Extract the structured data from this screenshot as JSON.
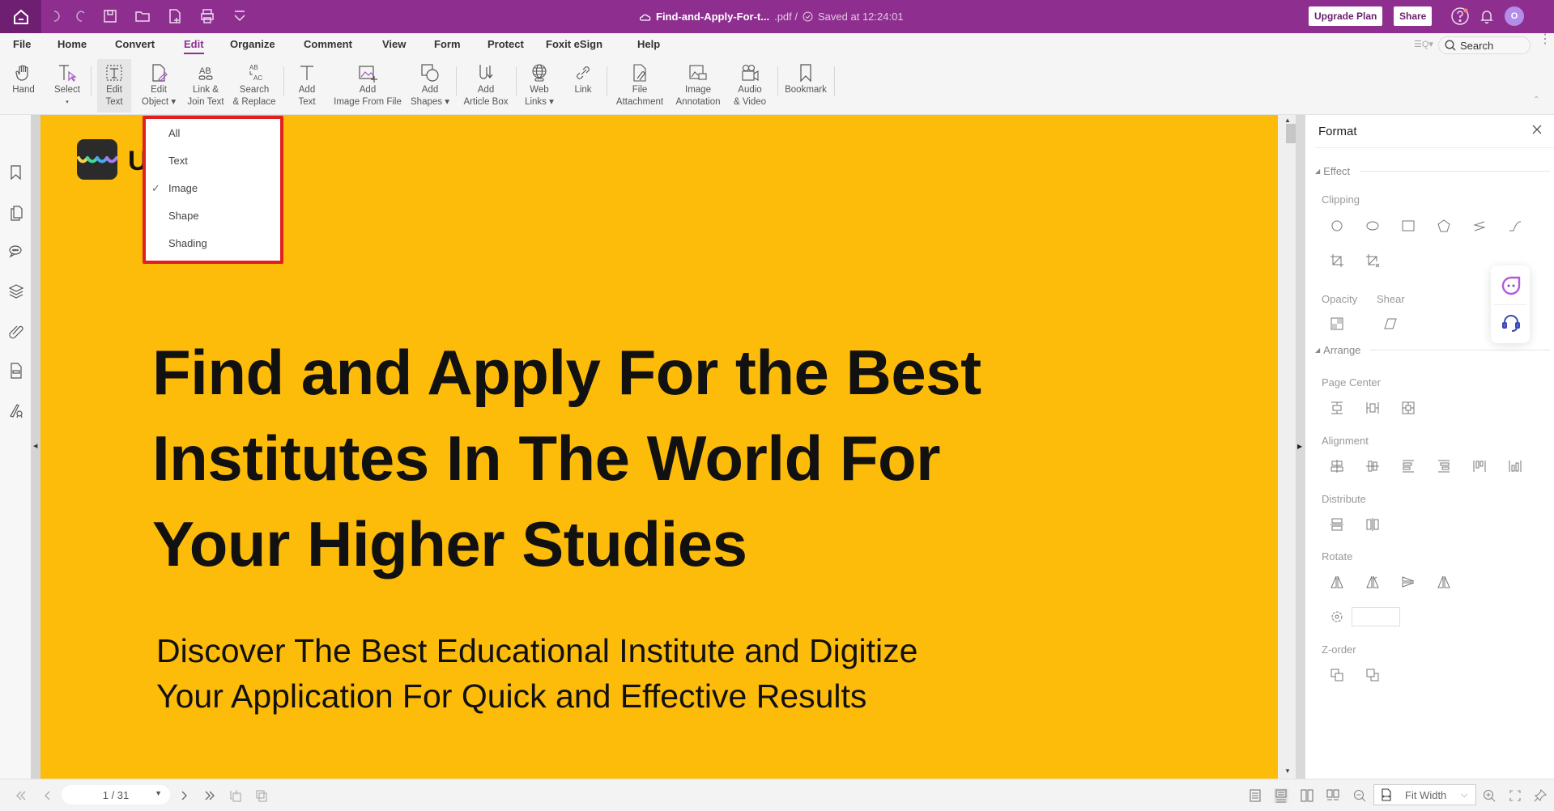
{
  "titlebar": {
    "quick_icons": [
      "home-icon",
      "undo-icon",
      "redo-icon",
      "save-icon",
      "open-folder-icon",
      "new-file-icon",
      "print-icon",
      "customize-dropdown-icon"
    ],
    "file_name": "Find-and-Apply-For-t...",
    "file_ext": ".pdf /",
    "save_status": "Saved at 12:24:01",
    "upgrade_label": "Upgrade Plan",
    "share_label": "Share",
    "avatar_initial": "O",
    "accent_color": "#8e2f90"
  },
  "menu": {
    "items": [
      "File",
      "Home",
      "Convert",
      "Edit",
      "Organize",
      "Comment",
      "View",
      "Form",
      "Protect",
      "Foxit eSign",
      "Help"
    ],
    "active": "Edit",
    "search_placeholder": "Search"
  },
  "toolbar": {
    "tools": [
      {
        "line1": "Hand",
        "line2": ""
      },
      {
        "line1": "Select",
        "line2": "▾"
      },
      {
        "line1": "Edit",
        "line2": "Text"
      },
      {
        "line1": "Edit",
        "line2": "Object ▾"
      },
      {
        "line1": "Link &",
        "line2": "Join Text"
      },
      {
        "line1": "Search",
        "line2": "& Replace"
      },
      {
        "line1": "Add",
        "line2": "Text"
      },
      {
        "line1": "Add",
        "line2": "Image From File"
      },
      {
        "line1": "Add",
        "line2": "Shapes ▾"
      },
      {
        "line1": "Add",
        "line2": "Article Box"
      },
      {
        "line1": "Web",
        "line2": "Links ▾"
      },
      {
        "line1": "Link",
        "line2": ""
      },
      {
        "line1": "File",
        "line2": "Attachment"
      },
      {
        "line1": "Image",
        "line2": "Annotation"
      },
      {
        "line1": "Audio",
        "line2": "& Video"
      },
      {
        "line1": "Bookmark",
        "line2": ""
      }
    ],
    "active_tool": "Edit Text"
  },
  "edit_object_dropdown": {
    "items": [
      "All",
      "Text",
      "Image",
      "Shape",
      "Shading"
    ],
    "checked": "Image"
  },
  "left_sidebar": {
    "icons": [
      "bookmark-icon",
      "pages-icon",
      "comments-icon",
      "layers-icon",
      "attachment-icon",
      "form-field-icon",
      "signature-icon"
    ]
  },
  "document": {
    "logo_letter": "U",
    "headline_lines": [
      "Find and Apply For the Best",
      "Institutes In The World For",
      "Your Higher Studies"
    ],
    "subline_lines": [
      "Discover The Best Educational Institute and Digitize",
      "Your Application For Quick and Effective Results"
    ],
    "background_color": "#fdbb0a"
  },
  "format_panel": {
    "title": "Format",
    "effect_label": "Effect",
    "clipping_label": "Clipping",
    "opacity_label": "Opacity",
    "shear_label": "Shear",
    "arrange_label": "Arrange",
    "page_center_label": "Page Center",
    "alignment_label": "Alignment",
    "distribute_label": "Distribute",
    "rotate_label": "Rotate",
    "rotate_value": "",
    "zorder_label": "Z-order"
  },
  "statusbar": {
    "page_indicator": "1 / 31",
    "zoom_mode": "Fit Width"
  }
}
